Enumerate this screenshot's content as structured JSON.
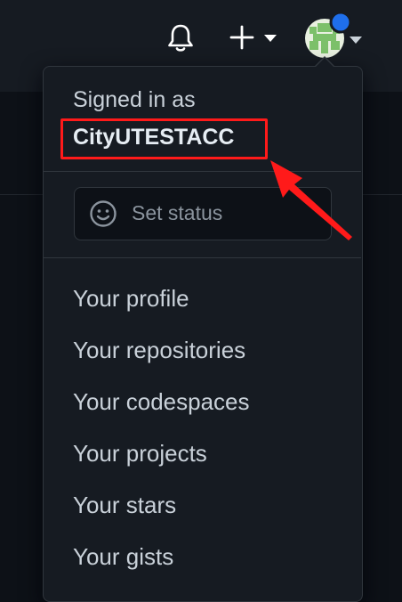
{
  "header": {
    "bell_icon": "bell-icon",
    "create_icon": "plus-icon",
    "avatar_icon": "identicon-avatar",
    "unread_dot_color": "#1f6feb"
  },
  "menu": {
    "signed_in_label": "Signed in as",
    "username": "CityUTESTACC",
    "set_status_label": "Set status",
    "set_status_icon": "smiley-icon",
    "items": [
      {
        "label": "Your profile"
      },
      {
        "label": "Your repositories"
      },
      {
        "label": "Your codespaces"
      },
      {
        "label": "Your projects"
      },
      {
        "label": "Your stars"
      },
      {
        "label": "Your gists"
      }
    ]
  },
  "annotation": {
    "highlight_color": "#ff1a1a",
    "arrow_color": "#ff1a1a"
  }
}
